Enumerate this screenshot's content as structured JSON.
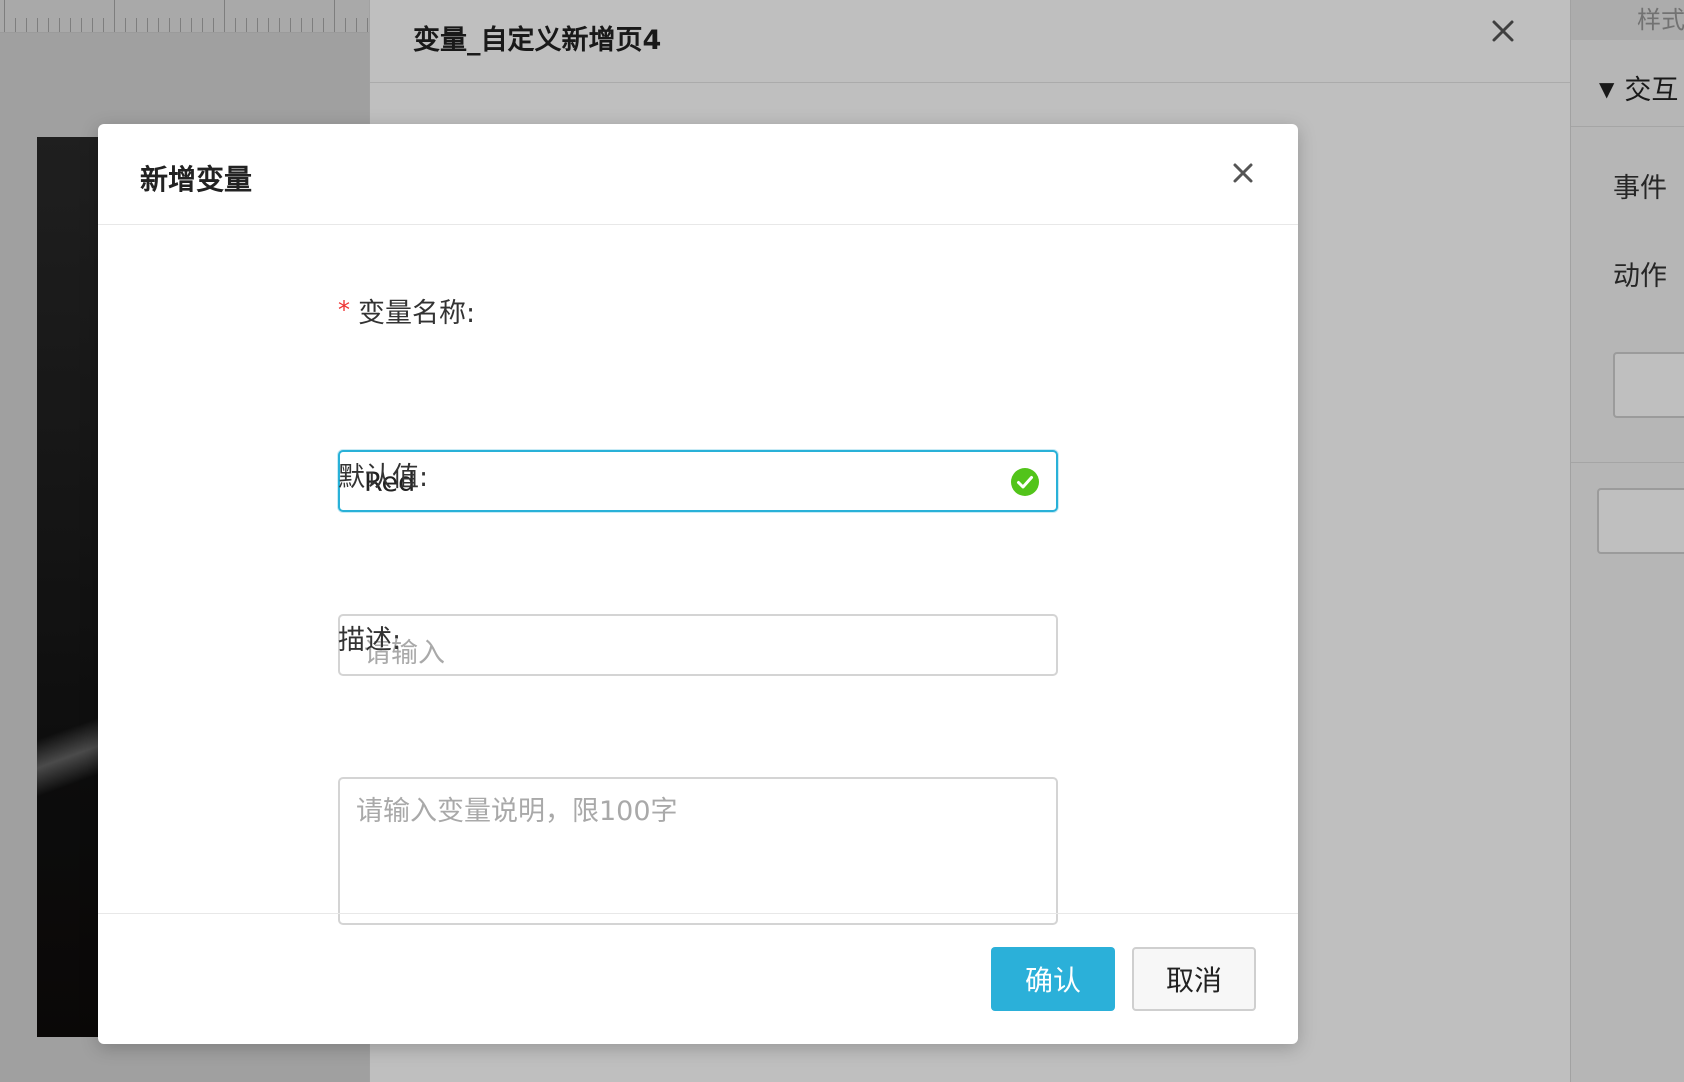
{
  "background": {
    "variable_panel": {
      "title": "变量_自定义新增页4",
      "close_icon": "close-icon"
    },
    "property_panel": {
      "tab_label": "样式",
      "section_title": "交互",
      "section_toggle_icon": "triangle-down-icon",
      "event_label": "事件",
      "action_label": "动作"
    }
  },
  "dialog": {
    "title": "新增变量",
    "close_icon": "close-icon",
    "fields": {
      "name": {
        "label": "变量名称:",
        "required_mark": "*",
        "value": "Red",
        "status_icon": "check-circle-icon",
        "status_color": "#52c41a"
      },
      "default_value": {
        "label": "默认值:",
        "value": "",
        "placeholder": "请输入"
      },
      "description": {
        "label": "描述:",
        "value": "",
        "placeholder": "请输入变量说明，限100字"
      }
    },
    "buttons": {
      "confirm": "确认",
      "cancel": "取消"
    }
  },
  "colors": {
    "primary": "#2bb0d9",
    "active_border": "#29b1d8",
    "required": "#e33333",
    "success": "#52c41a"
  }
}
